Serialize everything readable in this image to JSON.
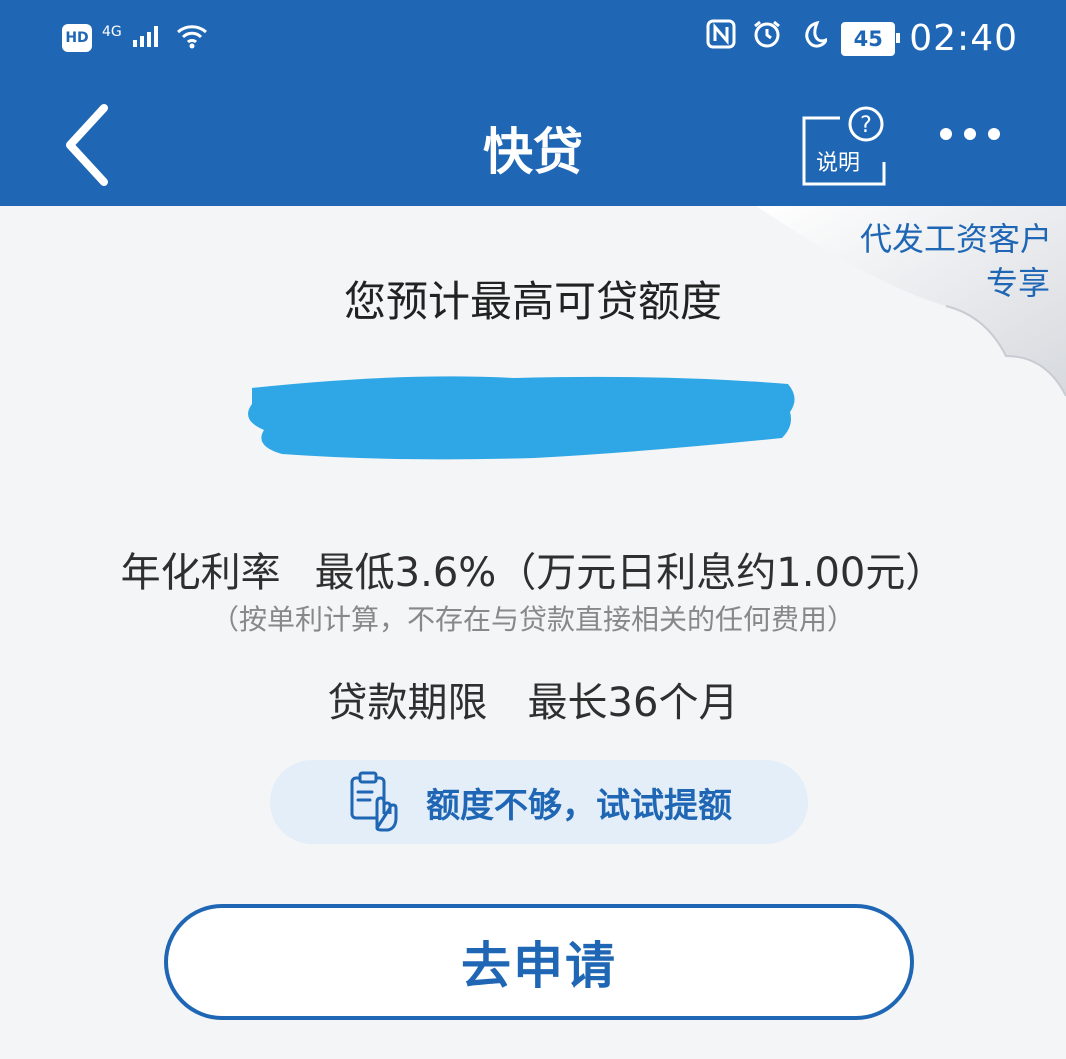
{
  "status_bar": {
    "hd": "HD",
    "network": "4G",
    "battery": "45",
    "time": "02:40"
  },
  "header": {
    "title": "快贷",
    "help_label": "说明",
    "accent": "#1f67b5"
  },
  "ribbon": {
    "line1": "代发工资客户",
    "line2": "专享"
  },
  "loan": {
    "estimate_label": "您预计最高可贷额度",
    "rate_label": "年化利率",
    "rate_value": "最低3.6%（万元日利息约1.00元）",
    "rate_note": "（按单利计算，不存在与贷款直接相关的任何费用）",
    "term_label": "贷款期限",
    "term_value": "最长36个月"
  },
  "actions": {
    "boost_label": "额度不够，试试提额",
    "apply_label": "去申请"
  }
}
